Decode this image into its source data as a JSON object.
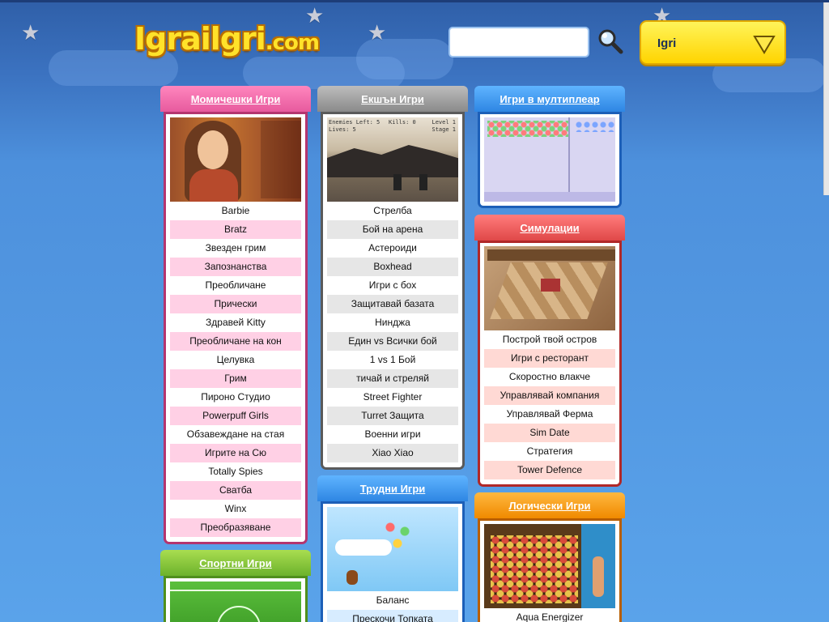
{
  "header": {
    "logo_main": "Igrailgri",
    "logo_suffix": ".com",
    "search_placeholder": "",
    "search_value": "",
    "dropdown_selected": "Igri"
  },
  "columns": {
    "girls": {
      "title": "Момичешки Игри",
      "items": [
        "Barbie",
        "Bratz",
        "Звезден грим",
        "Запознанства",
        "Преобличане",
        "Прически",
        "Здравей Kitty",
        "Преобличане на кон",
        "Целувка",
        "Грим",
        "Пироно Студио",
        "Powerpuff Girls",
        "Обзавеждане на стая",
        "Игрите на Сю",
        "Totally Spies",
        "Сватба",
        "Winx",
        "Преобразяване"
      ]
    },
    "action": {
      "title": "Екшън Игри",
      "items": [
        "Стрелба",
        "Бой на арена",
        "Астероиди",
        "Boxhead",
        "Игри с бох",
        "Защитавай базата",
        "Нинджа",
        "Един vs Всички бой",
        "1 vs 1 Бой",
        "тичай и стреляй",
        "Street Fighter",
        "Turret Защита",
        "Военни игри",
        "Xiao Xiao"
      ],
      "thumb_hud": [
        "Enemies Left: 5",
        "Kills: 0",
        "Level 1",
        "Lives: 5",
        "Stage 1"
      ]
    },
    "multiplayer": {
      "title": "Игри в мултиплеар"
    },
    "simulation": {
      "title": "Симулации",
      "items": [
        "Построй твой остров",
        "Игри с ресторант",
        "Скоростно влакче",
        "Управлявай компания",
        "Управлявай Ферма",
        "Sim Date",
        "Стратегия",
        "Tower Defence"
      ]
    },
    "sports": {
      "title": "Спортни Игри"
    },
    "hard": {
      "title": "Трудни Игри",
      "items": [
        "Баланс",
        "Прескочи Топката"
      ]
    },
    "logic": {
      "title": "Логически Игри",
      "items": [
        "Aqua Energizer"
      ]
    }
  },
  "colors": {
    "pink": "#e75a9e",
    "gray": "#8a8a8a",
    "blue": "#2e86e3",
    "red": "#e04848",
    "green": "#6cb22c",
    "orange": "#f08a00",
    "logo": "#ffe22a"
  }
}
